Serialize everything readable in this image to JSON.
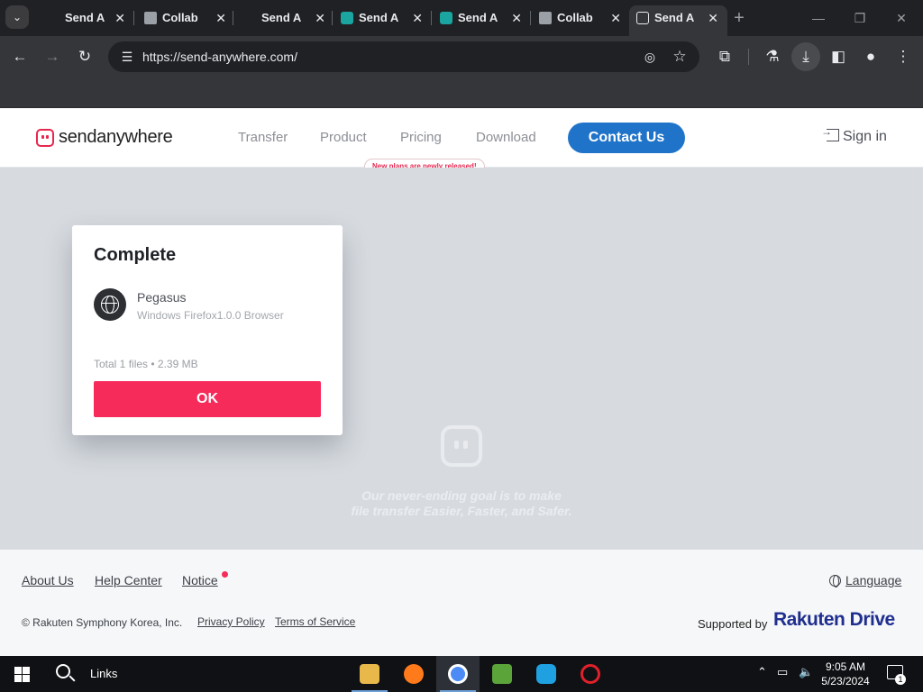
{
  "browser": {
    "tabs": [
      {
        "label": "Send A",
        "favicon": "send-anywhere"
      },
      {
        "label": "Collab",
        "favicon": "collab"
      },
      {
        "label": "Send A",
        "favicon": "blank"
      },
      {
        "label": "Send A",
        "favicon": "teal-f"
      },
      {
        "label": "Send A",
        "favicon": "teal-f"
      },
      {
        "label": "Collab",
        "favicon": "collab"
      },
      {
        "label": "Send A",
        "favicon": "send-anywhere",
        "active": true
      }
    ],
    "new_tab_icon": "plus-icon",
    "url": "https://send-anywhere.com/"
  },
  "header": {
    "logo_text": "sendanywhere",
    "nav": [
      "Transfer",
      "Product",
      "Pricing",
      "Download"
    ],
    "promo_text": "New plans are newly released!",
    "contact_label": "Contact Us",
    "signin_label": "Sign in"
  },
  "main": {
    "slogan_line1": "Our never-ending goal is to make",
    "slogan_line2": "file transfer Easier, Faster, and Safer.",
    "card": {
      "title": "Complete",
      "device_name": "Pegasus",
      "device_desc": "Windows Firefox1.0.0 Browser",
      "files_info": "Total 1 files • 2.39 MB",
      "ok_label": "OK"
    }
  },
  "footer": {
    "links": [
      "About Us",
      "Help Center",
      "Notice"
    ],
    "language_label": "Language",
    "copyright": "© Rakuten Symphony Korea, Inc.",
    "privacy_label": "Privacy Policy",
    "terms_label": "Terms of Service",
    "supported_by": "Supported by",
    "rakuten_logo": "Rakuten Drive"
  },
  "taskbar": {
    "search_text": "Links",
    "time": "9:05 AM",
    "date": "5/23/2024",
    "notification_count": "1"
  },
  "colors": {
    "brand_red": "#f62b5a",
    "contact_blue": "#1f73c9",
    "rakuten_blue": "#1f2f8f"
  }
}
